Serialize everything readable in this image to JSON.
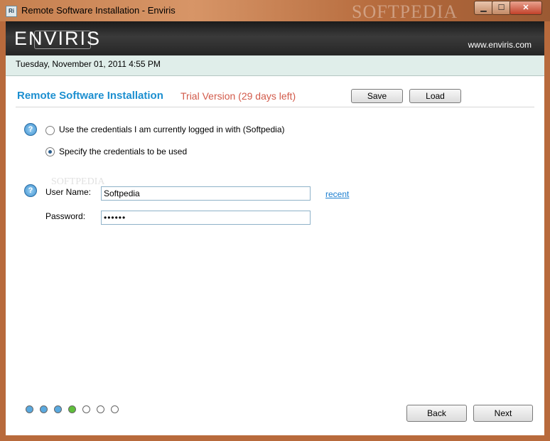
{
  "window": {
    "title": "Remote Software Installation - Enviris",
    "app_icon": "Ri",
    "watermark": "SOFTPEDIA"
  },
  "titlebar_buttons": {
    "minimize": "▁",
    "maximize": "☐",
    "close": "✕"
  },
  "banner": {
    "logo": "ENVIRIS",
    "url": "www.enviris.com"
  },
  "datebar": {
    "date": "Tuesday, November 01, 2011 4:55 PM"
  },
  "header": {
    "title": "Remote Software Installation",
    "trial": "Trial Version (29 days left)",
    "save_label": "Save",
    "load_label": "Load"
  },
  "credentials": {
    "option_current": "Use the credentials I am currently logged in with (Softpedia)",
    "option_specify": "Specify the credentials to be used",
    "selected": "specify"
  },
  "form": {
    "username_label": "User Name:",
    "username_value": "Softpedia",
    "password_label": "Password:",
    "password_value": "••••••",
    "recent_link": "recent",
    "watermark": "SOFTPEDIA"
  },
  "help_icon": "?",
  "wizard": {
    "steps": [
      "done",
      "done",
      "done",
      "current",
      "todo",
      "todo",
      "todo"
    ],
    "back_label": "Back",
    "next_label": "Next"
  },
  "colors": {
    "accent": "#1c8fd0",
    "trial": "#d25a4a",
    "step_done": "#5aa9df",
    "step_current": "#5fbf3a"
  }
}
